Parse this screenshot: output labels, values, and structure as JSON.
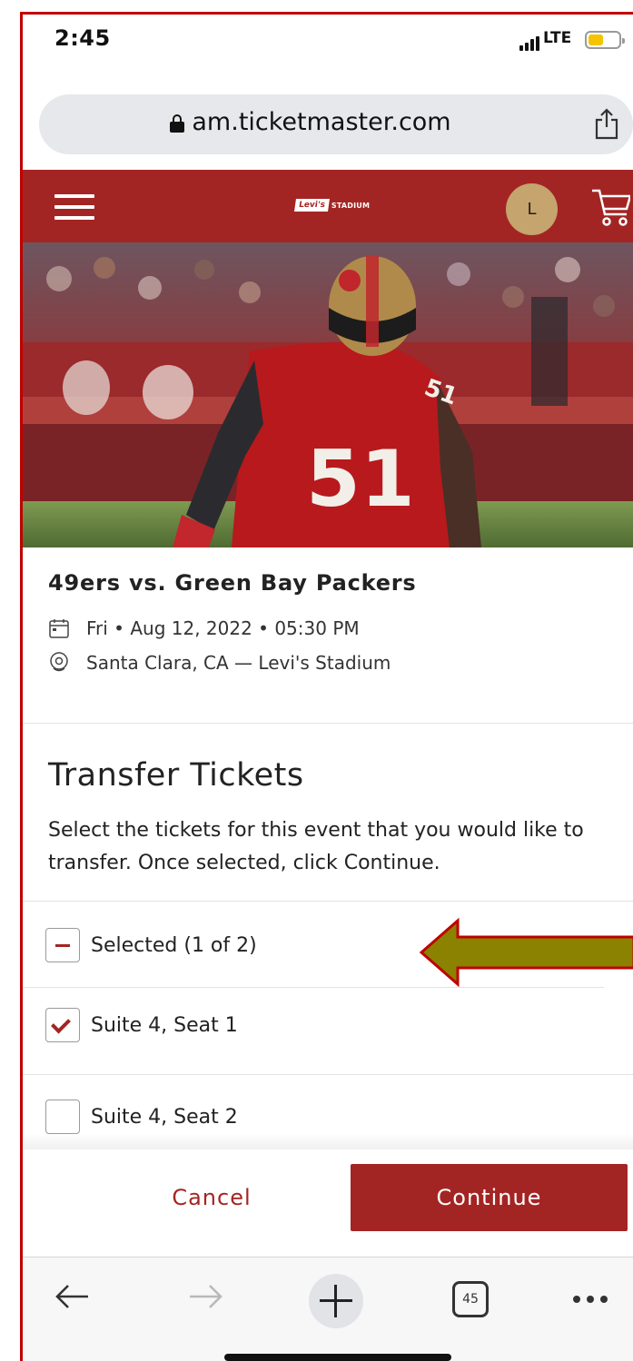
{
  "status_bar": {
    "time": "2:45",
    "network": "LTE"
  },
  "browser": {
    "url": "am.ticketmaster.com",
    "tab_count": "45"
  },
  "header": {
    "logo_badge": "Levi's",
    "logo_text": "STADIUM",
    "avatar_initial": "L"
  },
  "event": {
    "title": "49ers vs. Green Bay Packers",
    "datetime": "Fri • Aug 12, 2022 • 05:30 PM",
    "location": "Santa Clara, CA — Levi's Stadium",
    "hero_jersey_number": "51"
  },
  "transfer": {
    "title": "Transfer Tickets",
    "description": "Select the tickets for this event that you would like to transfer. Once selected, click Continue.",
    "select_all_label": "Selected (1 of 2)",
    "seats": [
      {
        "label": "Suite 4, Seat 1",
        "checked": true
      },
      {
        "label": "Suite 4, Seat 2",
        "checked": false
      }
    ]
  },
  "actions": {
    "cancel": "Cancel",
    "continue": "Continue"
  },
  "colors": {
    "brand": "#a32523",
    "annotation_arrow_fill": "#8a8200",
    "annotation_arrow_stroke": "#c00000"
  },
  "icons": [
    "lock-icon",
    "share-icon",
    "hamburger-icon",
    "cart-icon",
    "calendar-icon",
    "location-pin-icon",
    "back-arrow-icon",
    "forward-arrow-icon",
    "new-tab-icon",
    "tabs-icon",
    "more-icon"
  ]
}
